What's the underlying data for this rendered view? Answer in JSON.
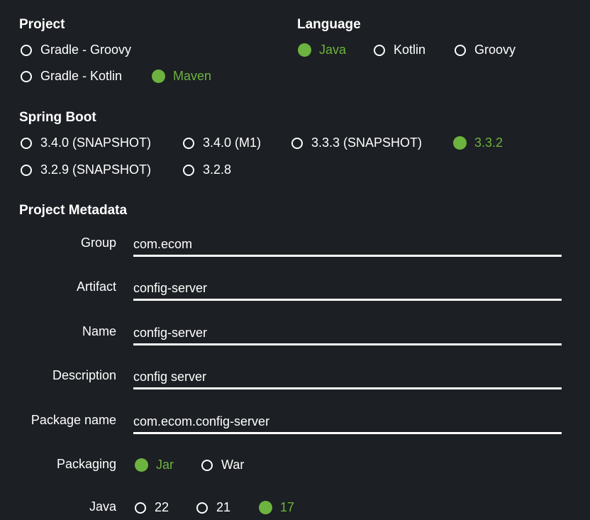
{
  "project": {
    "title": "Project",
    "options": [
      {
        "label": "Gradle - Groovy",
        "selected": false
      },
      {
        "label": "Gradle - Kotlin",
        "selected": false
      },
      {
        "label": "Maven",
        "selected": true
      }
    ]
  },
  "language": {
    "title": "Language",
    "options": [
      {
        "label": "Java",
        "selected": true
      },
      {
        "label": "Kotlin",
        "selected": false
      },
      {
        "label": "Groovy",
        "selected": false
      }
    ]
  },
  "spring_boot": {
    "title": "Spring Boot",
    "options": [
      {
        "label": "3.4.0 (SNAPSHOT)",
        "selected": false
      },
      {
        "label": "3.4.0 (M1)",
        "selected": false
      },
      {
        "label": "3.3.3 (SNAPSHOT)",
        "selected": false
      },
      {
        "label": "3.3.2",
        "selected": true
      },
      {
        "label": "3.2.9 (SNAPSHOT)",
        "selected": false
      },
      {
        "label": "3.2.8",
        "selected": false
      }
    ]
  },
  "metadata": {
    "title": "Project Metadata",
    "group": {
      "label": "Group",
      "value": "com.ecom"
    },
    "artifact": {
      "label": "Artifact",
      "value": "config-server"
    },
    "name": {
      "label": "Name",
      "value": "config-server"
    },
    "description": {
      "label": "Description",
      "value": "config server"
    },
    "package_name": {
      "label": "Package name",
      "value": "com.ecom.config-server"
    },
    "packaging": {
      "label": "Packaging",
      "options": [
        {
          "label": "Jar",
          "selected": true
        },
        {
          "label": "War",
          "selected": false
        }
      ]
    },
    "java": {
      "label": "Java",
      "options": [
        {
          "label": "22",
          "selected": false
        },
        {
          "label": "21",
          "selected": false
        },
        {
          "label": "17",
          "selected": true
        }
      ]
    }
  },
  "colors": {
    "accent": "#6db33f",
    "background": "#1c1f23",
    "text": "#ffffff"
  }
}
